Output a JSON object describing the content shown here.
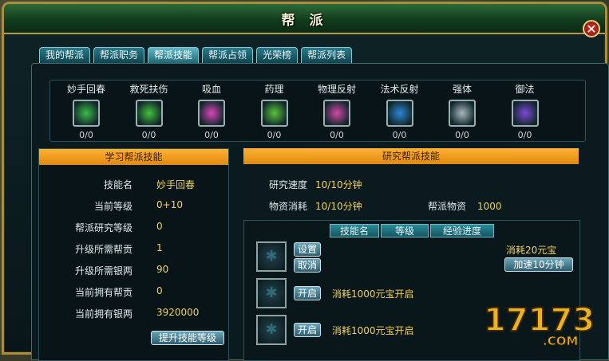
{
  "window": {
    "title": "帮  派",
    "close": "✕"
  },
  "tabs": [
    "我的帮派",
    "帮派职务",
    "帮派技能",
    "帮派占领",
    "光荣榜",
    "帮派列表"
  ],
  "active_tab": 2,
  "skills": [
    {
      "name": "妙手回春",
      "count": "0/0",
      "color": "#3dbb4a"
    },
    {
      "name": "救死扶伤",
      "count": "0/0",
      "color": "#44c13c"
    },
    {
      "name": "吸血",
      "count": "0/0",
      "color": "#d845b8"
    },
    {
      "name": "药理",
      "count": "0/0",
      "color": "#5ac43a"
    },
    {
      "name": "物理反射",
      "count": "0/0",
      "color": "#d449a8"
    },
    {
      "name": "法术反射",
      "count": "0/0",
      "color": "#2d86d6"
    },
    {
      "name": "强体",
      "count": "0/0",
      "color": "#aab6bf"
    },
    {
      "name": "御法",
      "count": "0/0",
      "color": "#7b4ad8"
    }
  ],
  "learn_panel": {
    "header": "学习帮派技能",
    "rows": [
      {
        "k": "技能名",
        "v": "妙手回春"
      },
      {
        "k": "当前等级",
        "v": "0+10"
      },
      {
        "k": "帮派研究等级",
        "v": "0"
      },
      {
        "k": "升级所需帮贡",
        "v": "1"
      },
      {
        "k": "升级所需银两",
        "v": "90"
      },
      {
        "k": "当前拥有帮贡",
        "v": "0"
      },
      {
        "k": "当前拥有银两",
        "v": "3920000"
      }
    ],
    "upgrade_button": "提升技能等级"
  },
  "research_panel": {
    "header": "研究帮派技能",
    "speed_label": "研究速度",
    "speed_value": "10/10分钟",
    "consume_label": "物资消耗",
    "consume_value": "10/10分钟",
    "supplies_label": "帮派物资",
    "supplies_value": "1000",
    "columns": [
      "技能名",
      "等级",
      "经验进度"
    ],
    "slot1": {
      "set": "设置",
      "cancel": "取消",
      "cost": "消耗20元宝",
      "speedup": "加速10分钟"
    },
    "slot2": {
      "open": "开启",
      "cost": "消耗1000元宝开启"
    },
    "slot3": {
      "open": "开启",
      "cost": "消耗1000元宝开启"
    }
  },
  "logo": {
    "text": "17173",
    "domain": ".COM"
  }
}
